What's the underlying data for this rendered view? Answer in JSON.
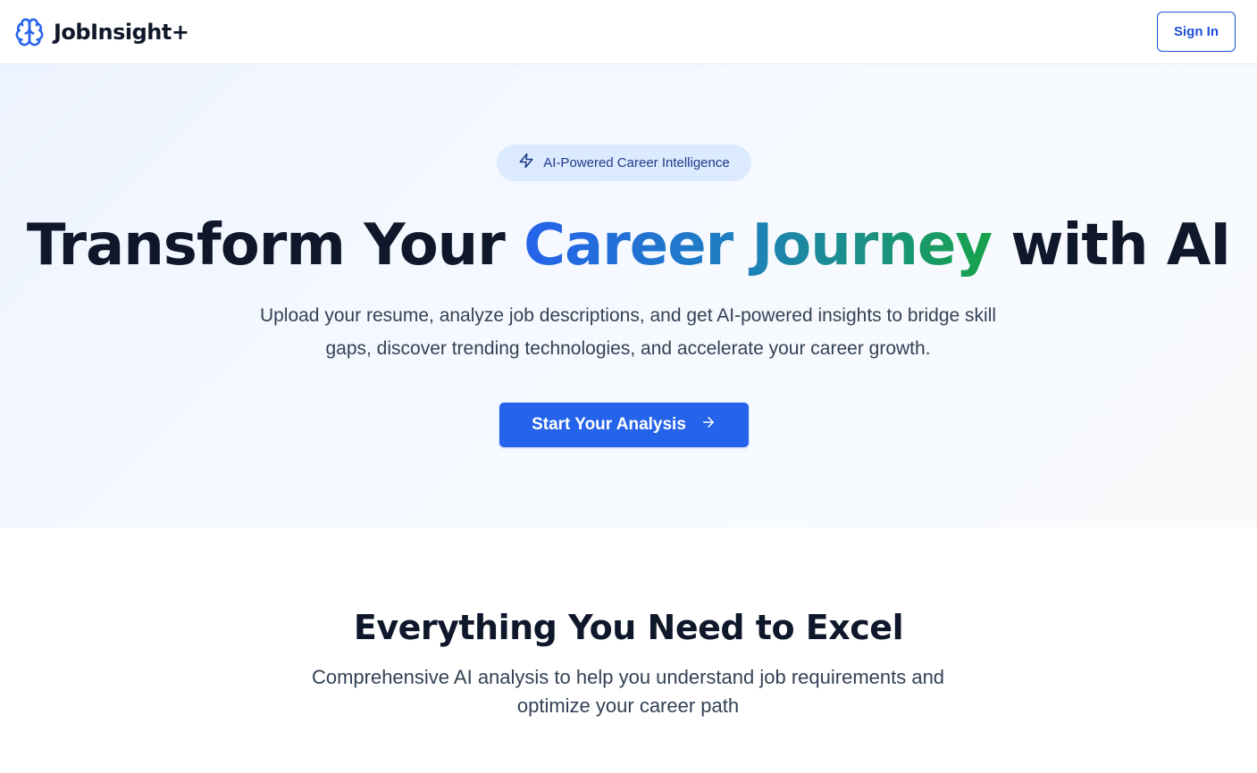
{
  "brand": {
    "name": "JobInsight+",
    "icon": "brain-icon",
    "color": "#2563eb"
  },
  "nav": {
    "signin_label": "Sign In"
  },
  "hero": {
    "badge_icon": "lightning-icon",
    "badge_text": "AI-Powered Career Intelligence",
    "title_part1": "Transform Your ",
    "title_highlight": "Career Journey",
    "title_part2": " with AI",
    "subtitle": "Upload your resume, analyze job descriptions, and get AI-powered insights to bridge skill gaps, discover trending technologies, and accelerate your career growth.",
    "cta_label": "Start Your Analysis",
    "cta_icon": "arrow-right-icon",
    "cta_color": "#2563eb",
    "gradient_colors": [
      "#2563eb",
      "#16a34a"
    ]
  },
  "features": {
    "title": "Everything You Need to Excel",
    "subtitle": "Comprehensive AI analysis to help you understand job requirements and optimize your career path"
  }
}
